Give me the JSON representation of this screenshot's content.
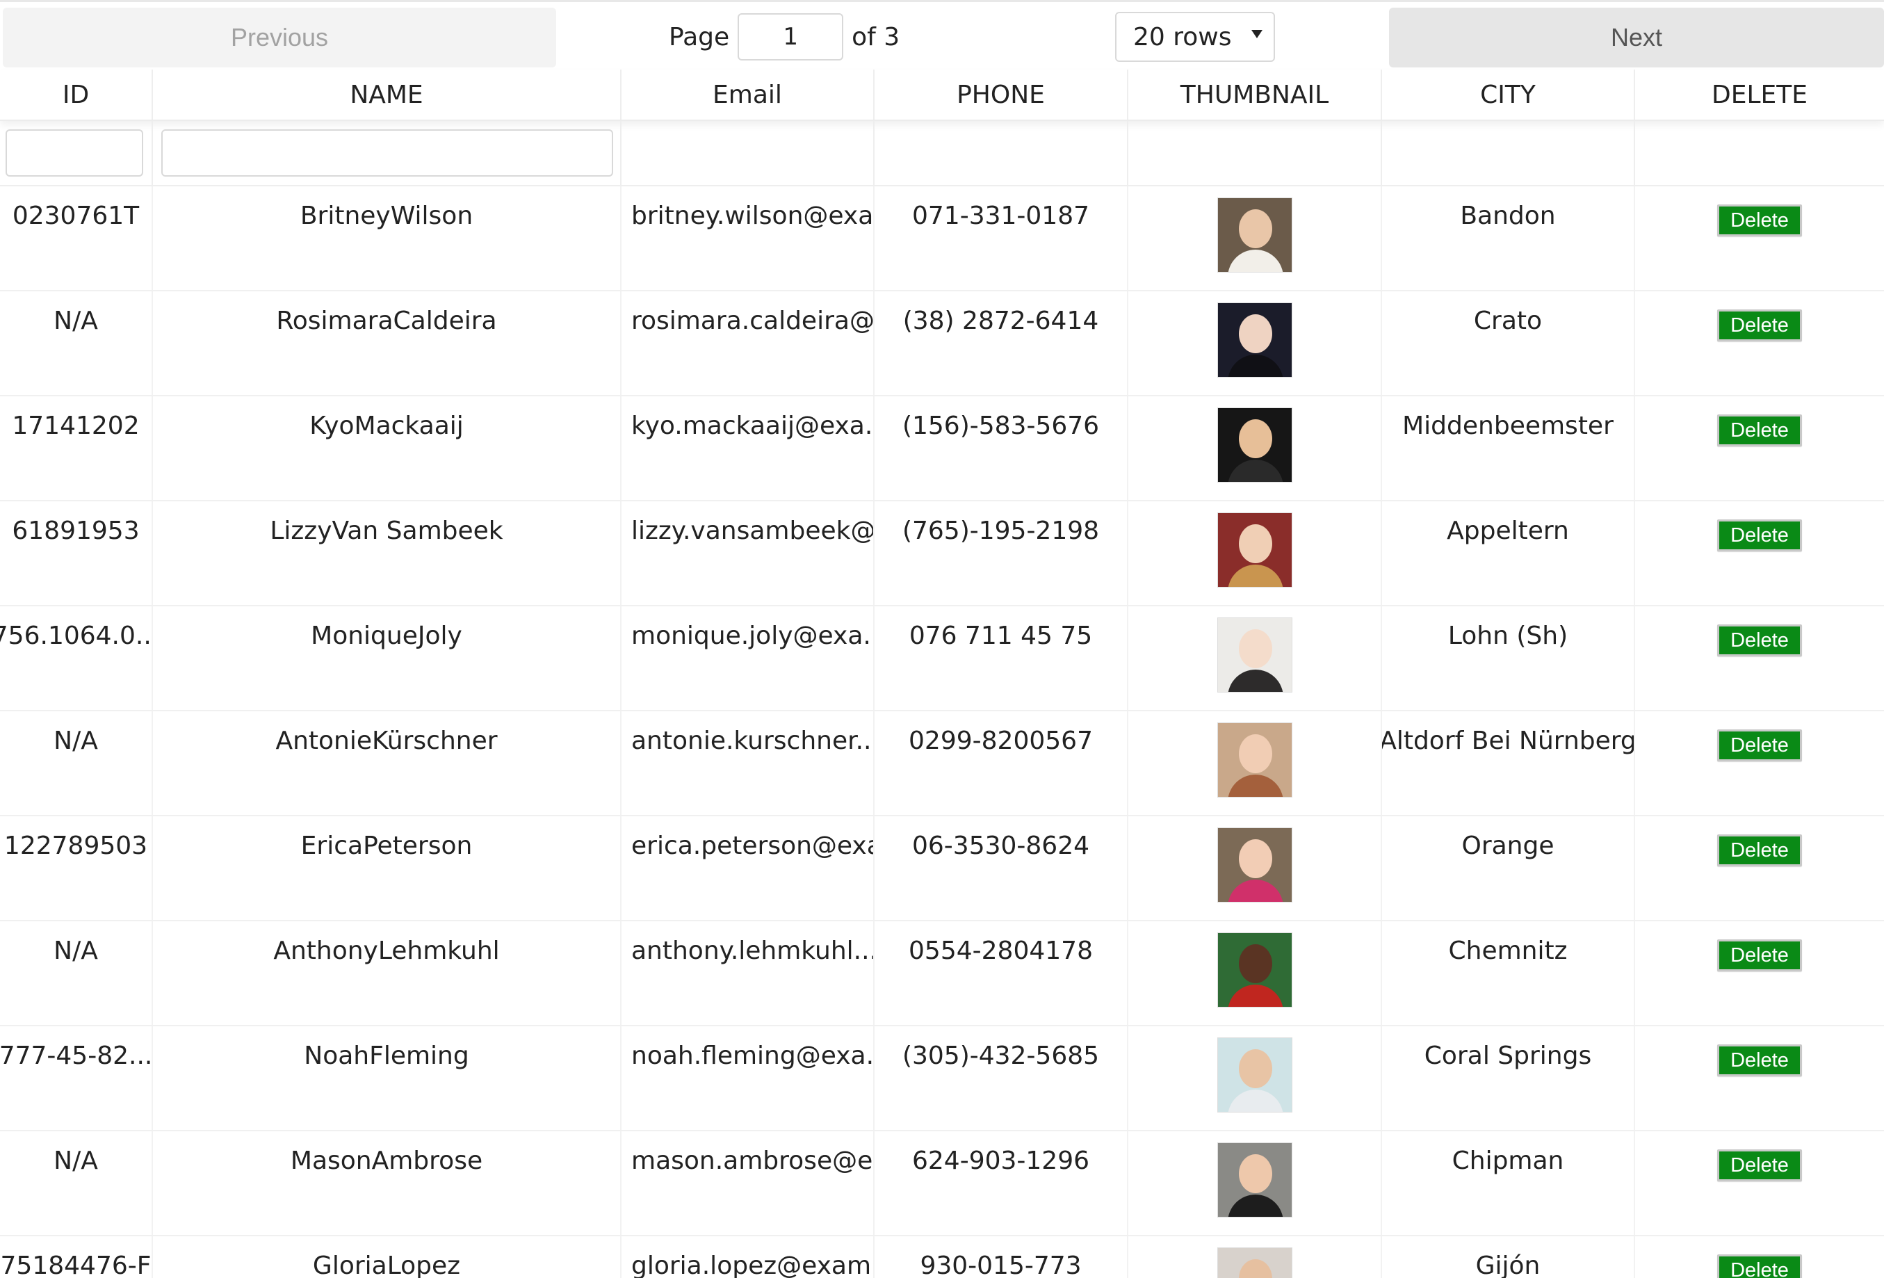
{
  "pagination": {
    "previous_label": "Previous",
    "next_label": "Next",
    "page_label": "Page",
    "page_value": "1",
    "of_label": "of 3",
    "rows_label": "20 rows"
  },
  "columns": [
    {
      "key": "id",
      "label": "ID"
    },
    {
      "key": "name",
      "label": "NAME"
    },
    {
      "key": "email",
      "label": "Email"
    },
    {
      "key": "phone",
      "label": "PHONE"
    },
    {
      "key": "thumbnail",
      "label": "THUMBNAIL"
    },
    {
      "key": "city",
      "label": "CITY"
    },
    {
      "key": "delete",
      "label": "DELETE"
    }
  ],
  "delete_label": "Delete",
  "colors": {
    "delete_button": "#0a8a16"
  },
  "rows": [
    {
      "id": "0230761T",
      "name": "BritneyWilson",
      "email": "britney.wilson@exa...",
      "phone": "071-331-0187",
      "city": "Bandon",
      "avatar": {
        "bg": "#6b5b4a",
        "skin": "#e9c6a8",
        "shirt": "#f2efe9"
      }
    },
    {
      "id": "N/A",
      "name": "RosimaraCaldeira",
      "email": "rosimara.caldeira@...",
      "phone": "(38) 2872-6414",
      "city": "Crato",
      "avatar": {
        "bg": "#1b1c2a",
        "skin": "#efd3c2",
        "shirt": "#101015"
      }
    },
    {
      "id": "17141202",
      "name": "KyoMackaaij",
      "email": "kyo.mackaaij@exa...",
      "phone": "(156)-583-5676",
      "city": "Middenbeemster",
      "avatar": {
        "bg": "#161616",
        "skin": "#e7bf98",
        "shirt": "#2a2a2a"
      }
    },
    {
      "id": "61891953",
      "name": "LizzyVan Sambeek",
      "email": "lizzy.vansambeek@...",
      "phone": "(765)-195-2198",
      "city": "Appeltern",
      "avatar": {
        "bg": "#8a2d2a",
        "skin": "#f0cfb5",
        "shirt": "#c9954f"
      }
    },
    {
      "id": "756.1064.0...",
      "name": "MoniqueJoly",
      "email": "monique.joly@exa...",
      "phone": "076 711 45 75",
      "city": "Lohn (Sh)",
      "avatar": {
        "bg": "#ecebe8",
        "skin": "#f4dccb",
        "shirt": "#2d2b2b"
      }
    },
    {
      "id": "N/A",
      "name": "AntonieKürschner",
      "email": "antonie.kurschner...",
      "phone": "0299-8200567",
      "city": "Altdorf Bei Nürnberg",
      "avatar": {
        "bg": "#c9a88a",
        "skin": "#f1cdb4",
        "shirt": "#a4603c"
      }
    },
    {
      "id": "122789503",
      "name": "EricaPeterson",
      "email": "erica.peterson@exa...",
      "phone": "06-3530-8624",
      "city": "Orange",
      "avatar": {
        "bg": "#7c6a56",
        "skin": "#f2cdb5",
        "shirt": "#d0306a"
      }
    },
    {
      "id": "N/A",
      "name": "AnthonyLehmkuhl",
      "email": "anthony.lehmkuhl...",
      "phone": "0554-2804178",
      "city": "Chemnitz",
      "avatar": {
        "bg": "#2f6b35",
        "skin": "#5a3423",
        "shirt": "#c0261f"
      }
    },
    {
      "id": "777-45-82...",
      "name": "NoahFleming",
      "email": "noah.fleming@exa...",
      "phone": "(305)-432-5685",
      "city": "Coral Springs",
      "avatar": {
        "bg": "#cfe3e6",
        "skin": "#e8c4a5",
        "shirt": "#e8ecef"
      }
    },
    {
      "id": "N/A",
      "name": "MasonAmbrose",
      "email": "mason.ambrose@e...",
      "phone": "624-903-1296",
      "city": "Chipman",
      "avatar": {
        "bg": "#8a8a86",
        "skin": "#eec8ab",
        "shirt": "#1d1d1d"
      }
    },
    {
      "id": "75184476-F",
      "name": "GloriaLopez",
      "email": "gloria.lopez@exam...",
      "phone": "930-015-773",
      "city": "Gijón",
      "avatar": {
        "bg": "#d8d2cc",
        "skin": "#e6c0a0",
        "shirt": "#5b3a2b"
      }
    }
  ]
}
